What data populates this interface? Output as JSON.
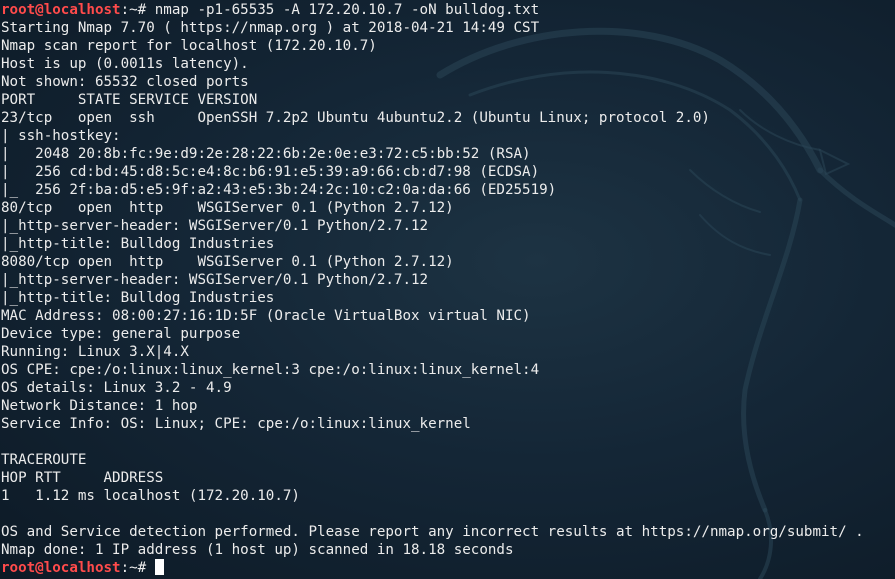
{
  "terminal": {
    "prompt_user": "root@localhost",
    "prompt_suffix": ":~# ",
    "command": "nmap -p1-65535 -A 172.20.10.7 -oN bulldog.txt",
    "output_lines": [
      "Starting Nmap 7.70 ( https://nmap.org ) at 2018-04-21 14:49 CST",
      "Nmap scan report for localhost (172.20.10.7)",
      "Host is up (0.0011s latency).",
      "Not shown: 65532 closed ports",
      "PORT     STATE SERVICE VERSION",
      "23/tcp   open  ssh     OpenSSH 7.2p2 Ubuntu 4ubuntu2.2 (Ubuntu Linux; protocol 2.0)",
      "| ssh-hostkey:",
      "|   2048 20:8b:fc:9e:d9:2e:28:22:6b:2e:0e:e3:72:c5:bb:52 (RSA)",
      "|   256 cd:bd:45:d8:5c:e4:8c:b6:91:e5:39:a9:66:cb:d7:98 (ECDSA)",
      "|_  256 2f:ba:d5:e5:9f:a2:43:e5:3b:24:2c:10:c2:0a:da:66 (ED25519)",
      "80/tcp   open  http    WSGIServer 0.1 (Python 2.7.12)",
      "|_http-server-header: WSGIServer/0.1 Python/2.7.12",
      "|_http-title: Bulldog Industries",
      "8080/tcp open  http    WSGIServer 0.1 (Python 2.7.12)",
      "|_http-server-header: WSGIServer/0.1 Python/2.7.12",
      "|_http-title: Bulldog Industries",
      "MAC Address: 08:00:27:16:1D:5F (Oracle VirtualBox virtual NIC)",
      "Device type: general purpose",
      "Running: Linux 3.X|4.X",
      "OS CPE: cpe:/o:linux:linux_kernel:3 cpe:/o:linux:linux_kernel:4",
      "OS details: Linux 3.2 - 4.9",
      "Network Distance: 1 hop",
      "Service Info: OS: Linux; CPE: cpe:/o:linux:linux_kernel",
      "",
      "TRACEROUTE",
      "HOP RTT     ADDRESS",
      "1   1.12 ms localhost (172.20.10.7)",
      "",
      "OS and Service detection performed. Please report any incorrect results at https://nmap.org/submit/ .",
      "Nmap done: 1 IP address (1 host up) scanned in 18.18 seconds"
    ],
    "final_prompt_user": "root@localhost",
    "final_prompt_suffix": ":~# ",
    "colors": {
      "prompt": "#ff4b4b",
      "text": "#ececec",
      "background": "#142636"
    }
  },
  "watermark": {
    "icon": "kali-dragon-icon"
  }
}
